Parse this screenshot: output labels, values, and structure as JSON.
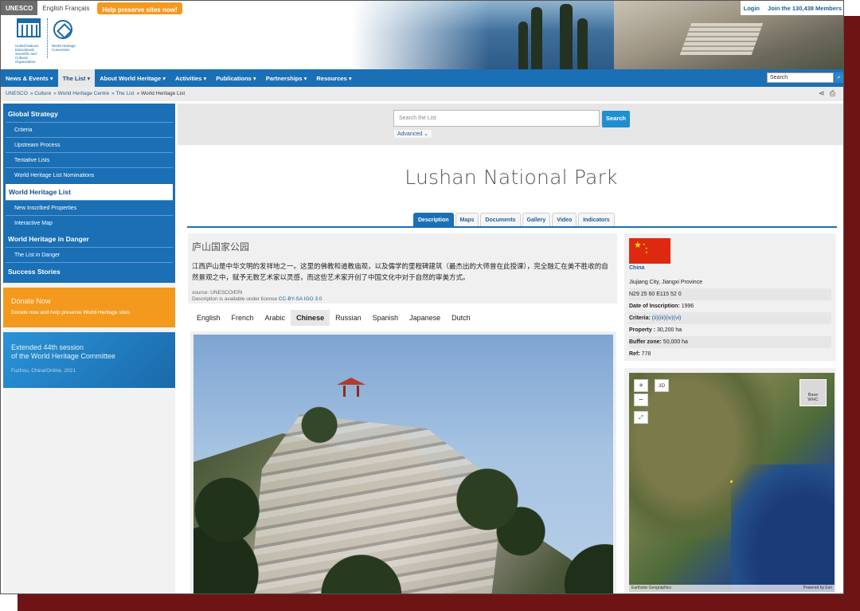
{
  "topbar": {
    "unesco": "UNESCO",
    "languages": "English Français",
    "preserve": "Help preserve sites now!",
    "login": "Login",
    "join": "Join the 130,438 Members"
  },
  "logo": {
    "unesco_text": "United Nations Educational, Scientific and Cultural Organization",
    "whc_text": "World Heritage Convention"
  },
  "nav": {
    "items": [
      "News & Events ▾",
      "The List ▾",
      "About World Heritage ▾",
      "Activities ▾",
      "Publications ▾",
      "Partnerships ▾",
      "Resources ▾"
    ],
    "search_value": "Search"
  },
  "breadcrumb": [
    "UNESCO",
    "» Culture",
    "» World Heritage Centre",
    "» The List",
    "» World Heritage List"
  ],
  "sidebar": {
    "items": [
      {
        "label": "Global Strategy"
      },
      {
        "label": "Criteria"
      },
      {
        "label": "Upstream Process"
      },
      {
        "label": "Tentative Lists"
      },
      {
        "label": "World Heritage List Nominations"
      },
      {
        "label": "World Heritage List"
      },
      {
        "label": "New Inscribed Properties"
      },
      {
        "label": "Interactive Map"
      },
      {
        "label": "World Heritage in Danger"
      },
      {
        "label": "The List in Danger"
      },
      {
        "label": "Success Stories"
      }
    ],
    "donate_title": "Donate Now",
    "donate_text": "Donate now and help preserve World Heritage sites",
    "session_line1": "Extended 44th session",
    "session_line2": "of the World Heritage Committee",
    "session_place": "Fuzhou, China/Online, 2021"
  },
  "search": {
    "placeholder": "Search the List",
    "button": "Search",
    "advanced": "Advanced ⌄"
  },
  "page_title": "Lushan National Park",
  "tabs": [
    "Description",
    "Maps",
    "Documents",
    "Gallery",
    "Video",
    "Indicators"
  ],
  "description": {
    "title": "庐山国家公园",
    "body": "江西庐山是中华文明的发祥地之一。这里的佛教和道教庙观，以及儒学的里程碑建筑（最杰出的大师曾在此授课），完全融汇在美不胜收的自然景观之中，赋予无数艺术家以灵感，而这些艺术家开创了中国文化中对于自然的审美方式。",
    "source": "source: UNESCO/ERI",
    "license_prefix": "Description is available under license",
    "license": "CC-BY-SA IGO 3.0"
  },
  "languages": [
    "English",
    "French",
    "Arabic",
    "Chinese",
    "Russian",
    "Spanish",
    "Japanese",
    "Dutch"
  ],
  "info": {
    "country": "China",
    "location": "Jiujiang City, Jiangxi Province",
    "coords": "N29 25 60 E115 52 0",
    "inscription_label": "Date of Inscription:",
    "inscription_value": "1996",
    "criteria_label": "Criteria:",
    "criteria_value": "(ii)(iii)(iv)(vi)",
    "property_label": "Property :",
    "property_value": "30,200 ha",
    "buffer_label": "Buffer zone:",
    "buffer_value": "50,000 ha",
    "ref_label": "Ref:",
    "ref_value": "778"
  },
  "map": {
    "plus": "+",
    "minus": "−",
    "three_d": "3D",
    "basemap_line1": "Base",
    "basemap_line2": "WHC",
    "attribution": "Earthstar Geographics",
    "powered": "Powered by Esri"
  }
}
